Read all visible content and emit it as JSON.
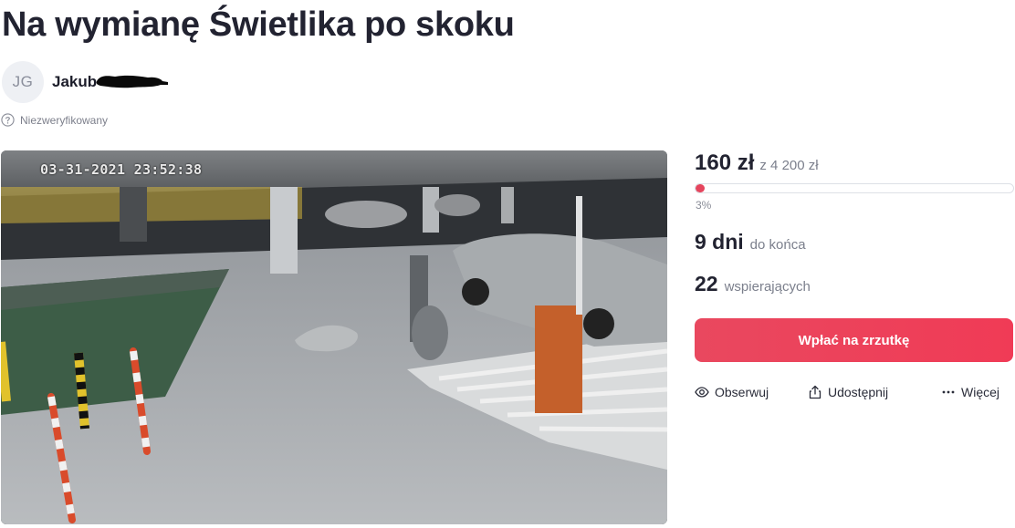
{
  "page": {
    "title": "Na wymianę Świetlika po skoku"
  },
  "author": {
    "initials": "JG",
    "name": "Jakub",
    "status": "Niezweryfikowany"
  },
  "media": {
    "timestamp": "03-31-2021 23:52:38"
  },
  "stats": {
    "raised": "160 zł",
    "goal_text": "z 4 200 zł",
    "progress_percent": 3,
    "progress_label": "3%",
    "days_value": "9 dni",
    "days_label": "do końca",
    "supporters_value": "22",
    "supporters_label": "wspierających"
  },
  "cta": {
    "label": "Wpłać na zrzutkę",
    "color": "#e9485f"
  },
  "actions": [
    {
      "label": "Obserwuj",
      "icon": "eye-icon"
    },
    {
      "label": "Udostępnij",
      "icon": "share-icon"
    },
    {
      "label": "Więcej",
      "icon": "more-dots-icon"
    }
  ]
}
